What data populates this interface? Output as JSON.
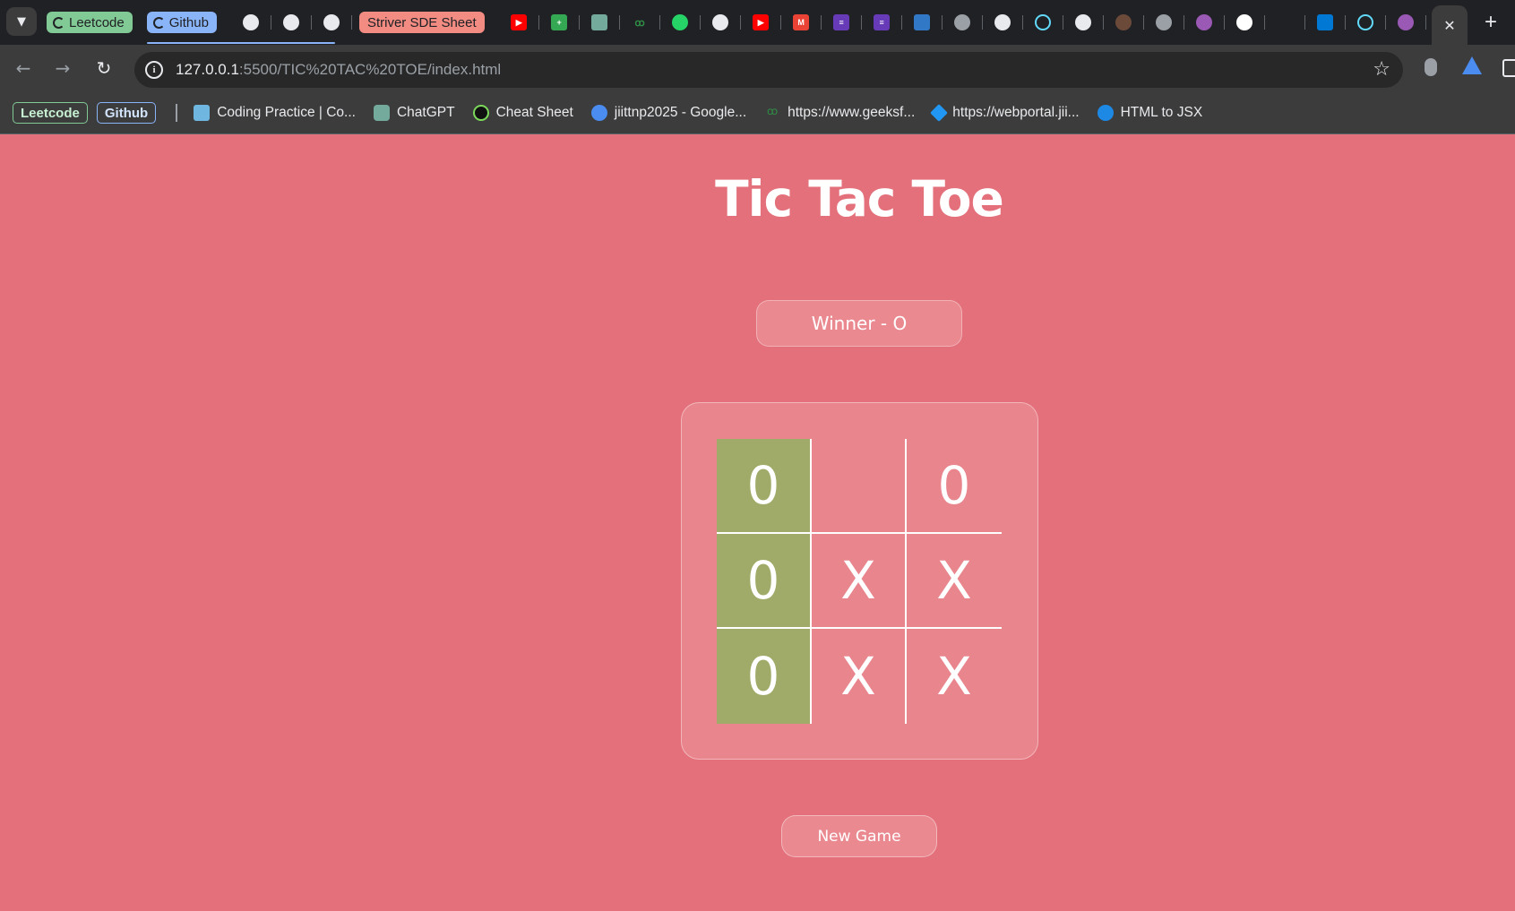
{
  "browser": {
    "tab_groups": [
      {
        "label": "Leetcode",
        "color": "#81c995"
      },
      {
        "label": "Github",
        "color": "#8ab4f8"
      },
      {
        "label": "Striver SDE Sheet",
        "color": "#f28b82"
      }
    ],
    "active_tab_close": "✕",
    "new_tab": "+",
    "url_host": "127.0.0.1",
    "url_rest": ":5500/TIC%20TAC%20TOE/index.html",
    "bookmarks": {
      "chips": [
        "Leetcode",
        "Github"
      ],
      "items": [
        "Coding Practice | Co...",
        "ChatGPT",
        "Cheat Sheet",
        "jiittnp2025 - Google...",
        "https://www.geeksf...",
        "https://webportal.jii...",
        "HTML to JSX"
      ]
    }
  },
  "game": {
    "title": "Tic Tac Toe",
    "status": "Winner - O",
    "board": [
      "0",
      "",
      "0",
      "0",
      "X",
      "X",
      "0",
      "X",
      "X"
    ],
    "winning_cells": [
      0,
      3,
      6
    ],
    "win_color": "#a1ab69",
    "new_game_label": "New Game"
  },
  "colors": {
    "page_bg": "#e3707a",
    "card_bg": "#e9858c"
  }
}
